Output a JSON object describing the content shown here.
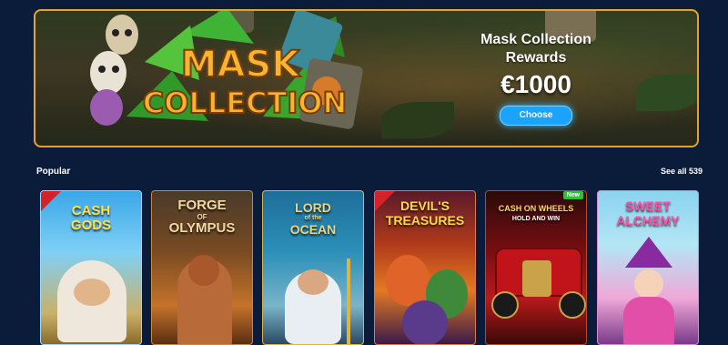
{
  "promo": {
    "logo_line1": "MASK",
    "logo_line2": "COLLECTION",
    "title_line1": "Mask Collection",
    "title_line2": "Rewards",
    "amount": "€1000",
    "cta": "Choose"
  },
  "section": {
    "title": "Popular",
    "see_all": "See all 539"
  },
  "games": [
    {
      "name": "CASH OF GODS",
      "title_line1": "CASH",
      "title_line2": "GODS",
      "badge": "red-corner"
    },
    {
      "name": "FORGE OF OLYMPUS",
      "title_line1": "FORGE",
      "title_line2": "OLYMPUS"
    },
    {
      "name": "LORD OF THE OCEAN",
      "title_line1": "LORD",
      "title_line2": "OCEAN"
    },
    {
      "name": "DEVIL'S TREASURES",
      "title_line1": "DEVIL'S",
      "title_line2": "TREASURES",
      "badge": "red-corner"
    },
    {
      "name": "CASH ON WHEELS HOLD AND WIN",
      "title_line1": "CASH ON WHEELS",
      "title_line2": "HOLD AND WIN",
      "badge_label": "New"
    },
    {
      "name": "SWEET ALCHEMY",
      "title_line1": "SWEET",
      "title_line2": "ALCHEMY"
    }
  ],
  "colors": {
    "page_bg": "#0b1c3a",
    "banner_border": "#e8a22a",
    "cta": "#1aa3ff",
    "logo_text": "#f7b52c",
    "new_badge": "#2fbf3a",
    "corner_badge": "#d4222a"
  }
}
